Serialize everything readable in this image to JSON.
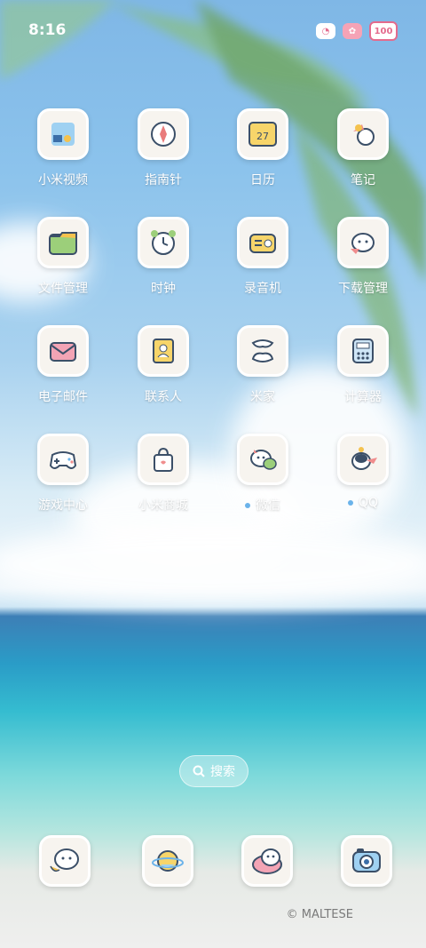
{
  "status_bar": {
    "time": "8:16",
    "battery": "100"
  },
  "apps": [
    {
      "name": "小米视频",
      "dot": false
    },
    {
      "name": "指南针",
      "dot": false
    },
    {
      "name": "日历",
      "dot": false,
      "calendar_day": "27"
    },
    {
      "name": "笔记",
      "dot": false
    },
    {
      "name": "文件管理",
      "dot": false
    },
    {
      "name": "时钟",
      "dot": false
    },
    {
      "name": "录音机",
      "dot": false
    },
    {
      "name": "下载管理",
      "dot": false
    },
    {
      "name": "电子邮件",
      "dot": false
    },
    {
      "name": "联系人",
      "dot": false
    },
    {
      "name": "米家",
      "dot": false
    },
    {
      "name": "计算器",
      "dot": false
    },
    {
      "name": "游戏中心",
      "dot": false
    },
    {
      "name": "小米商城",
      "dot": false
    },
    {
      "name": "微信",
      "dot": true
    },
    {
      "name": "QQ",
      "dot": true
    }
  ],
  "search": {
    "label": "搜索"
  },
  "watermark": "© MALTESE",
  "colors": {
    "accent": "#6bb3ea",
    "icon_bg": "#f7f4ef"
  }
}
